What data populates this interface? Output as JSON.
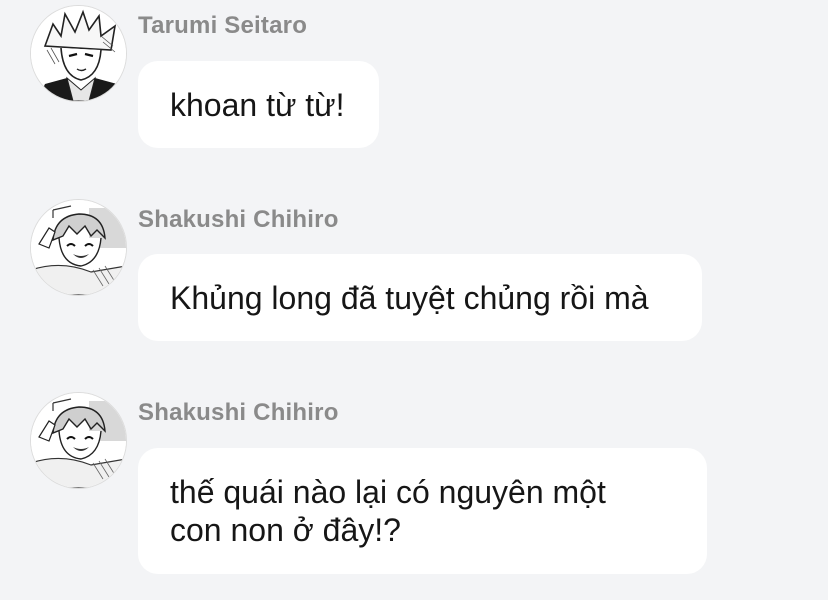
{
  "messages": [
    {
      "sender": "Tarumi Seitaro",
      "avatar_icon": "manga-portrait-blond-icon",
      "lines": [
        "khoan từ từ!"
      ]
    },
    {
      "sender": "Shakushi Chihiro",
      "avatar_icon": "manga-portrait-smiling-icon",
      "lines": [
        "Khủng long đã tuyệt chủng rồi mà"
      ]
    },
    {
      "sender": "Shakushi Chihiro",
      "avatar_icon": "manga-portrait-smiling-icon",
      "lines": [
        "thế quái nào lại có nguyên một",
        "con non ở đây!?"
      ]
    }
  ],
  "colors": {
    "background": "#f3f4f6",
    "bubble": "#ffffff",
    "sender_name": "#8a8a8a",
    "message_text": "#161616"
  }
}
